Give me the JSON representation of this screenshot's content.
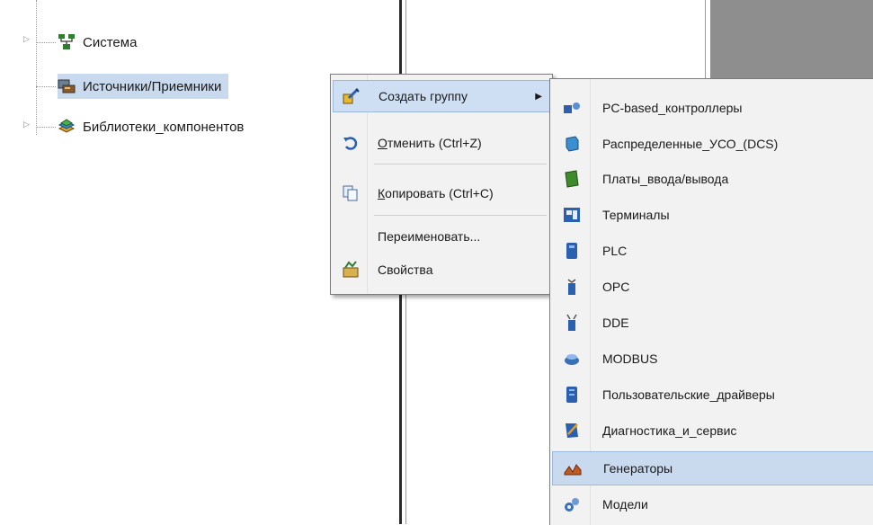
{
  "tree": {
    "items": [
      {
        "label": "Система",
        "icon": "network-icon"
      },
      {
        "label": "Источники/Приемники",
        "icon": "devices-icon"
      },
      {
        "label": "Библиотеки_компонентов",
        "icon": "library-icon"
      }
    ]
  },
  "context_menu": {
    "items": [
      {
        "label": "Создать группу",
        "icon": "create-group-icon",
        "has_submenu": true
      },
      {
        "label_underlined": "О",
        "label_rest": "тменить (Ctrl+Z)",
        "icon": "undo-icon"
      },
      {
        "label_underlined": "К",
        "label_rest": "опировать (Ctrl+C)",
        "icon": "copy-icon"
      },
      {
        "label": "Переименовать...",
        "icon": ""
      },
      {
        "label": "Свойства",
        "icon": "properties-icon"
      }
    ]
  },
  "submenu": {
    "items": [
      {
        "label": "PC-based_контроллеры",
        "icon": "pc-controller-icon"
      },
      {
        "label": "Распределенные_УСО_(DCS)",
        "icon": "dcs-icon"
      },
      {
        "label": "Платы_ввода/вывода",
        "icon": "io-board-icon"
      },
      {
        "label": "Терминалы",
        "icon": "terminal-icon"
      },
      {
        "label": "PLC",
        "icon": "plc-icon"
      },
      {
        "label": "OPC",
        "icon": "opc-icon"
      },
      {
        "label": "DDE",
        "icon": "dde-icon"
      },
      {
        "label": "MODBUS",
        "icon": "modbus-icon"
      },
      {
        "label": "Пользовательские_драйверы",
        "icon": "user-driver-icon"
      },
      {
        "label": "Диагностика_и_сервис",
        "icon": "diagnostics-icon"
      },
      {
        "label": "Генераторы",
        "icon": "generator-icon"
      },
      {
        "label": "Модели",
        "icon": "models-icon"
      }
    ]
  },
  "colors": {
    "highlight": "#c9d9ee",
    "menu_bg": "#f2f2f2",
    "gray_panel": "#8e8e8e"
  }
}
